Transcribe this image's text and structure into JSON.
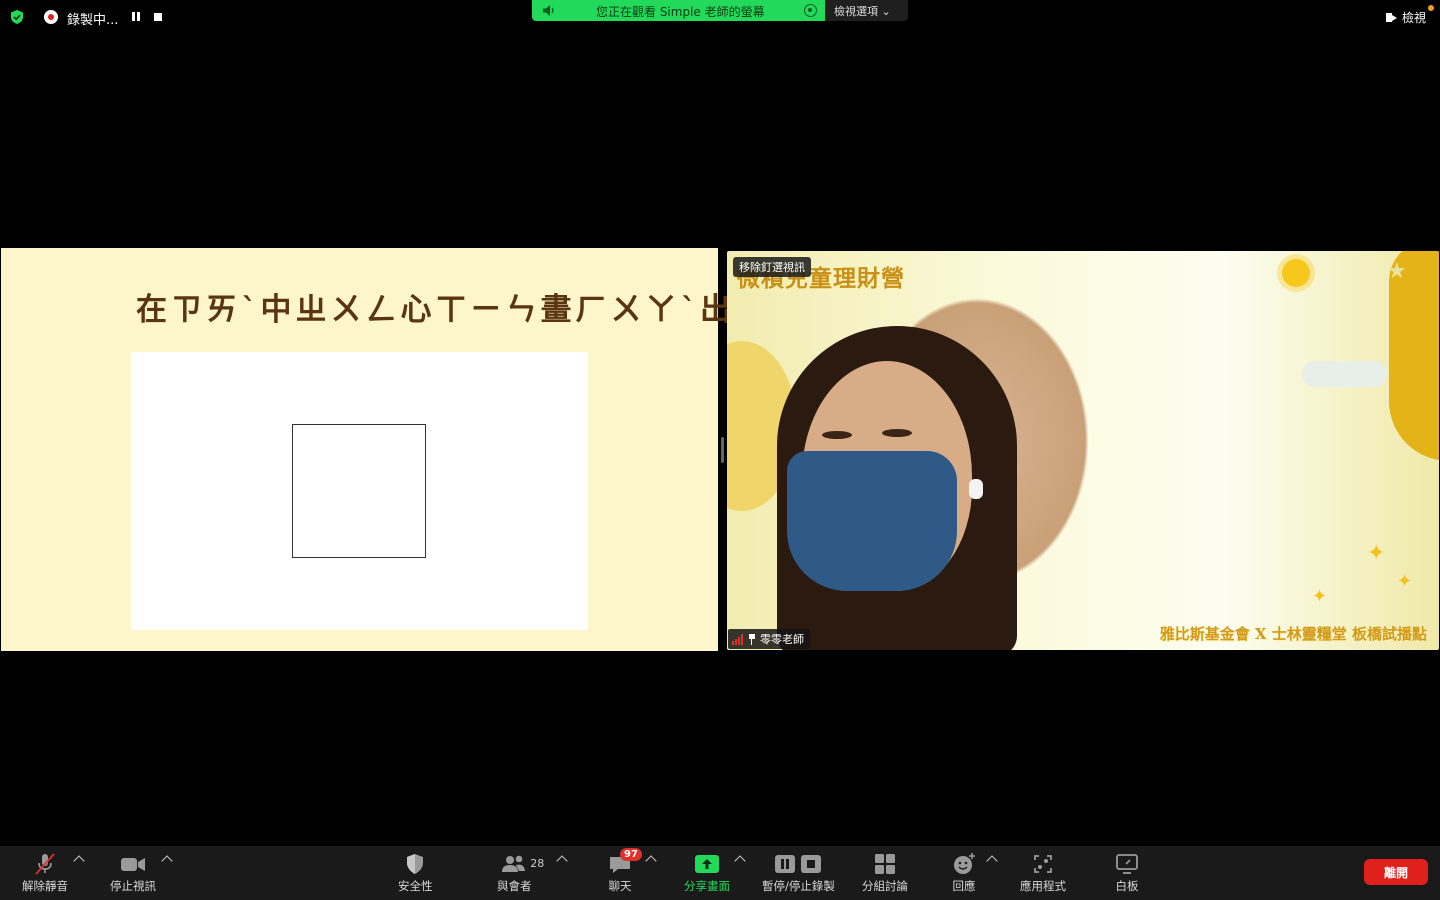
{
  "top_bar": {
    "recording_label": "錄製中...",
    "share_banner_text": "您正在觀看 Simple 老師的螢幕",
    "view_options_label": "檢視選項",
    "view_label": "檢視"
  },
  "shared_screen": {
    "slide_title": "在ㄗㄞˋ中ㄓㄨㄥ心ㄒㄧㄣ畫ㄏㄨㄚˋ出ㄔㄨ一ㄧ個ㄍㄜˋ區ㄑㄩ域ㄩˋ"
  },
  "video": {
    "unpin_label": "移除釘選視訊",
    "participant_name": "零零老師",
    "background_banner": "微積兒童理財營",
    "background_footer": "雅比斯基金會 X 士林靈糧堂 板橋試播點"
  },
  "toolbar": {
    "unmute": "解除靜音",
    "stop_video": "停止視訊",
    "security": "安全性",
    "participants": "與會者",
    "participants_count": "28",
    "chat": "聊天",
    "chat_badge": "97",
    "share_screen": "分享畫面",
    "pause_stop_recording": "暫停/停止錄製",
    "breakout_rooms": "分組討論",
    "reactions": "回應",
    "apps": "應用程式",
    "whiteboard": "白板",
    "leave": "離開"
  },
  "colors": {
    "share_green": "#23d959",
    "leave_red": "#e0201c",
    "slide_bg": "#fef6cb",
    "title_brown": "#5a3512"
  }
}
